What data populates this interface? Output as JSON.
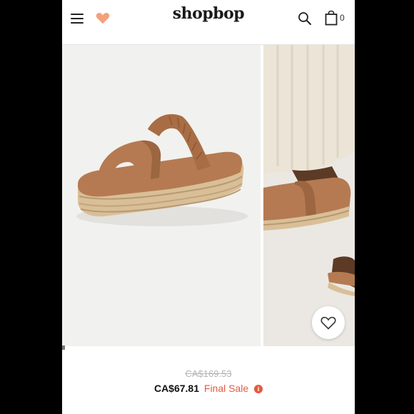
{
  "header": {
    "logo": "shopbop",
    "bag_count": "0"
  },
  "product": {
    "original_price": "CA$169.53",
    "sale_price": "CA$67.81",
    "sale_label": "Final Sale",
    "info_symbol": "i"
  },
  "colors": {
    "accent": "#e8593c",
    "heart": "#f5a07c",
    "text": "#111111"
  },
  "icons": [
    "menu-icon",
    "heart-icon",
    "search-icon",
    "shopping-bag-icon",
    "wishlist-heart-icon",
    "info-icon"
  ]
}
